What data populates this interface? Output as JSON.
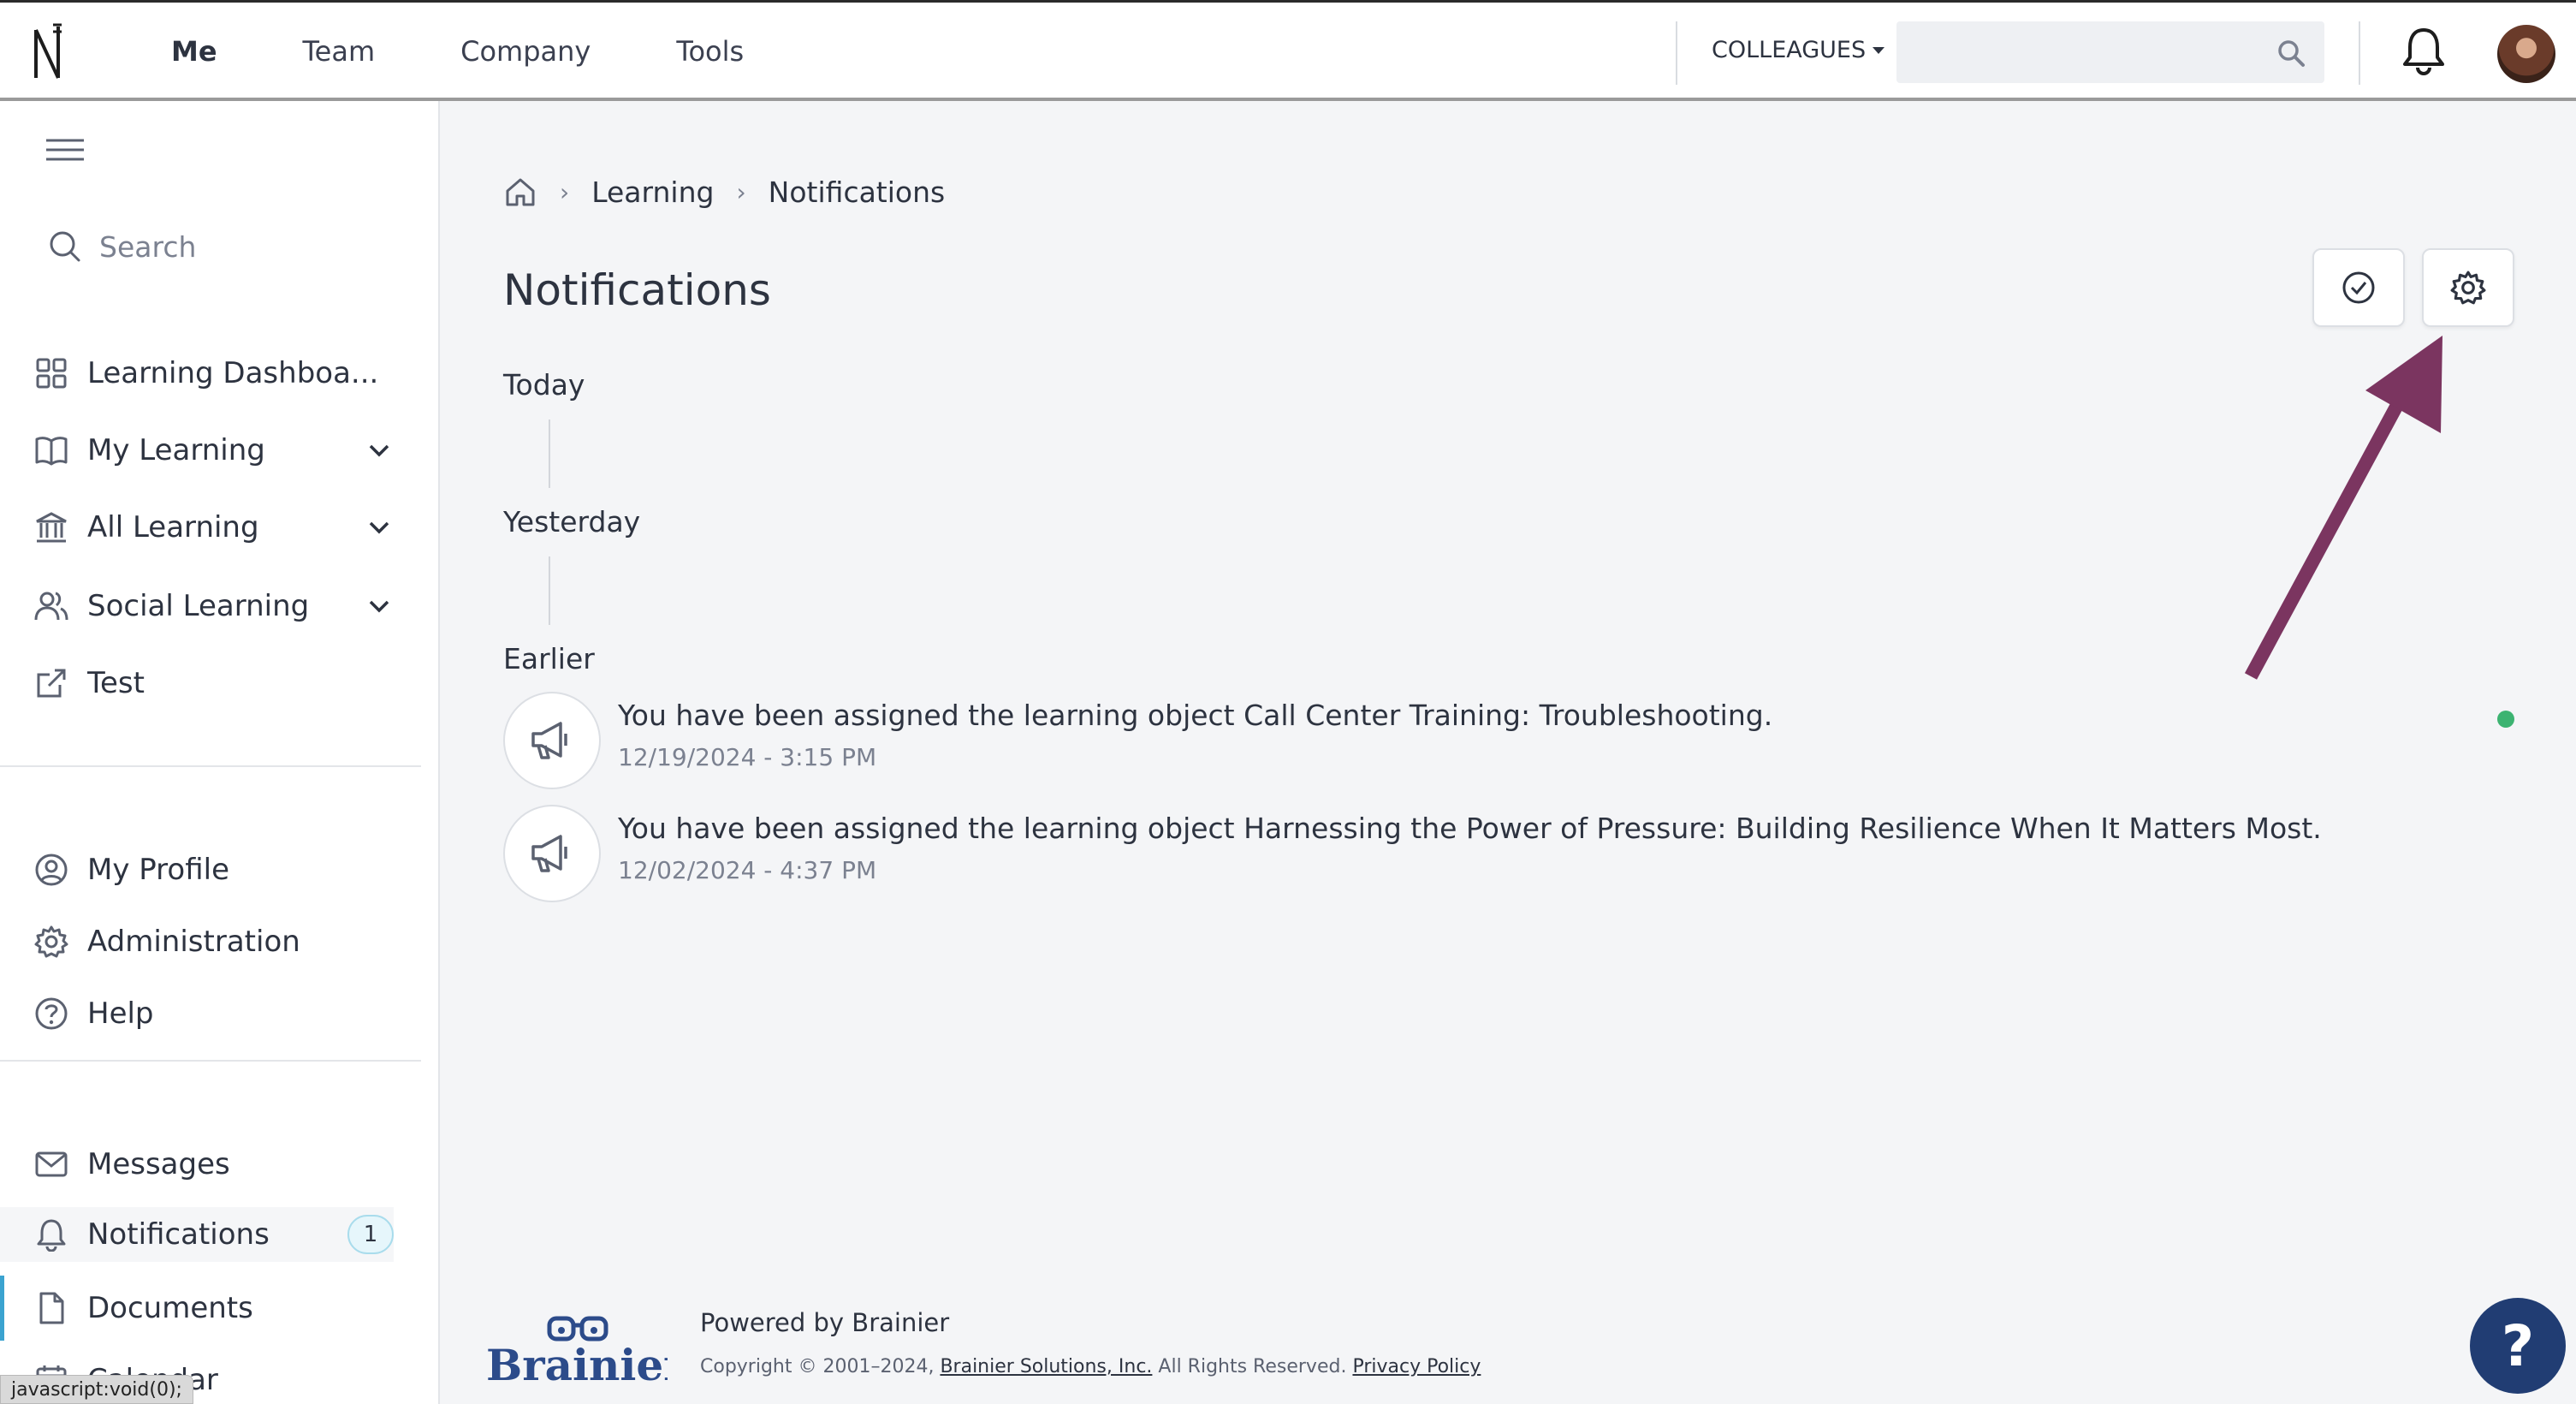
{
  "topbar": {
    "nav": [
      "Me",
      "Team",
      "Company",
      "Tools"
    ],
    "colleagues_label": "COLLEAGUES",
    "search_placeholder": ""
  },
  "sidebar": {
    "search_label": "Search",
    "primary_items": [
      {
        "label": "Learning Dashboa...",
        "icon": "grid-icon"
      },
      {
        "label": "My Learning",
        "icon": "book-icon",
        "expandable": true
      },
      {
        "label": "All Learning",
        "icon": "institution-icon",
        "expandable": true
      },
      {
        "label": "Social Learning",
        "icon": "people-icon",
        "expandable": true
      },
      {
        "label": "Test",
        "icon": "external-link-icon"
      }
    ],
    "secondary_items": [
      {
        "label": "My Profile",
        "icon": "user-circle-icon"
      },
      {
        "label": "Administration",
        "icon": "gear-icon"
      },
      {
        "label": "Help",
        "icon": "question-circle-icon"
      }
    ],
    "tertiary_items": [
      {
        "label": "Messages",
        "icon": "envelope-icon"
      },
      {
        "label": "Notifications",
        "icon": "bell-icon",
        "badge": "1",
        "active": true
      },
      {
        "label": "Documents",
        "icon": "document-icon"
      },
      {
        "label": "Calendar",
        "icon": "calendar-icon"
      }
    ],
    "status_text": "javascript:void(0);"
  },
  "breadcrumb": [
    "Learning",
    "Notifications"
  ],
  "page_title": "Notifications",
  "groups": {
    "today": "Today",
    "yesterday": "Yesterday",
    "earlier": "Earlier"
  },
  "notifications": [
    {
      "message": "You have been assigned the learning object Call Center Training: Troubleshooting.",
      "timestamp": "12/19/2024 - 3:15 PM",
      "unread": true
    },
    {
      "message": "You have been assigned the learning object Harnessing the Power of Pressure: Building Resilience When It Matters Most.",
      "timestamp": "12/02/2024 - 4:37 PM",
      "unread": false
    }
  ],
  "footer": {
    "logo_text": "Brainier",
    "powered_by": "Powered by Brainier",
    "copyright_prefix": "Copyright © 2001–2024,",
    "company_link": "Brainier Solutions, Inc.",
    "rights": "All Rights Reserved.",
    "privacy_link": "Privacy Policy"
  },
  "help_fab": "?",
  "colors": {
    "accent": "#3ba3d0",
    "unread_dot": "#3cb371",
    "annotation_arrow": "#7b3560",
    "fab": "#213d73"
  }
}
